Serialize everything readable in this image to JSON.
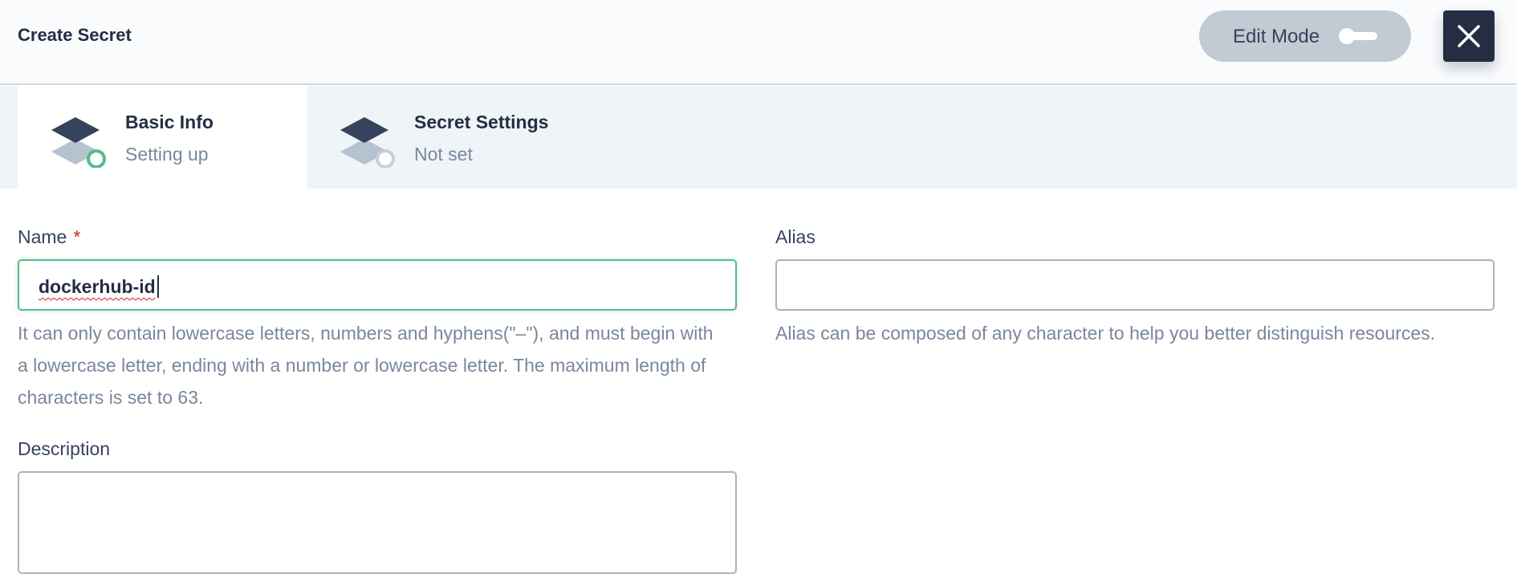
{
  "header": {
    "title": "Create Secret",
    "edit_mode_label": "Edit Mode",
    "edit_mode_on": false
  },
  "steps": [
    {
      "title": "Basic Info",
      "status": "Setting up",
      "active": true
    },
    {
      "title": "Secret Settings",
      "status": "Not set",
      "active": false
    }
  ],
  "form": {
    "name": {
      "label": "Name",
      "required_mark": "*",
      "value": "dockerhub-id",
      "help": "It can only contain lowercase letters, numbers and hyphens(\"–\"), and must begin with a lowercase letter, ending with a number or lowercase letter. The maximum length of characters is set to 63."
    },
    "alias": {
      "label": "Alias",
      "value": "",
      "help": "Alias can be composed of any character to help you better distinguish resources."
    },
    "description": {
      "label": "Description",
      "value": ""
    }
  },
  "icons": {
    "close": "close-icon",
    "step": "layers-icon"
  },
  "colors": {
    "primary_dark": "#242e42",
    "active_green": "#55bc8a",
    "muted_text": "#79879c",
    "required_red": "#ca2621",
    "toggle_bg": "#c2cbd4"
  }
}
